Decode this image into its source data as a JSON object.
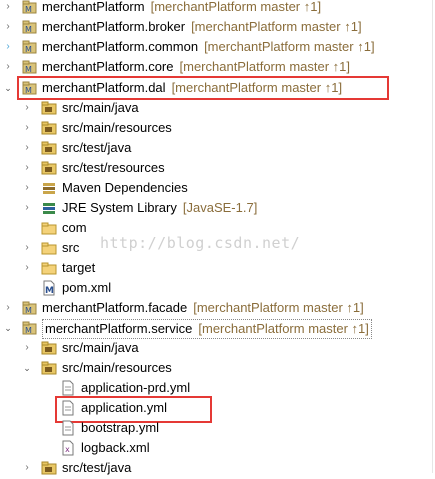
{
  "rows": [
    {
      "label": "merchantPlatform",
      "deco": "[merchantPlatform master ↑1]"
    },
    {
      "label": "merchantPlatform.broker",
      "deco": "[merchantPlatform master ↑1]"
    },
    {
      "label": "merchantPlatform.common",
      "deco": "[merchantPlatform master ↑1]"
    },
    {
      "label": "merchantPlatform.core",
      "deco": "[merchantPlatform master ↑1]"
    },
    {
      "label": "merchantPlatform.dal",
      "deco": "[merchantPlatform master ↑1]"
    },
    {
      "label": "src/main/java",
      "deco": ""
    },
    {
      "label": "src/main/resources",
      "deco": ""
    },
    {
      "label": "src/test/java",
      "deco": ""
    },
    {
      "label": "src/test/resources",
      "deco": ""
    },
    {
      "label": "Maven Dependencies",
      "deco": ""
    },
    {
      "label": "JRE System Library",
      "deco": "[JavaSE-1.7]"
    },
    {
      "label": "com",
      "deco": ""
    },
    {
      "label": "src",
      "deco": ""
    },
    {
      "label": "target",
      "deco": ""
    },
    {
      "label": "pom.xml",
      "deco": ""
    },
    {
      "label": "merchantPlatform.facade",
      "deco": "[merchantPlatform master ↑1]"
    },
    {
      "label": "merchantPlatform.service",
      "deco": "[merchantPlatform master ↑1]"
    },
    {
      "label": "src/main/java",
      "deco": ""
    },
    {
      "label": "src/main/resources",
      "deco": ""
    },
    {
      "label": "application-prd.yml",
      "deco": ""
    },
    {
      "label": "application.yml",
      "deco": ""
    },
    {
      "label": "bootstrap.yml",
      "deco": ""
    },
    {
      "label": "logback.xml",
      "deco": ""
    },
    {
      "label": "src/test/java",
      "deco": ""
    }
  ],
  "watermark": "http://blog.csdn.net/",
  "colors": {
    "decoration": "#8a6d3b",
    "highlight": "#e53935"
  }
}
